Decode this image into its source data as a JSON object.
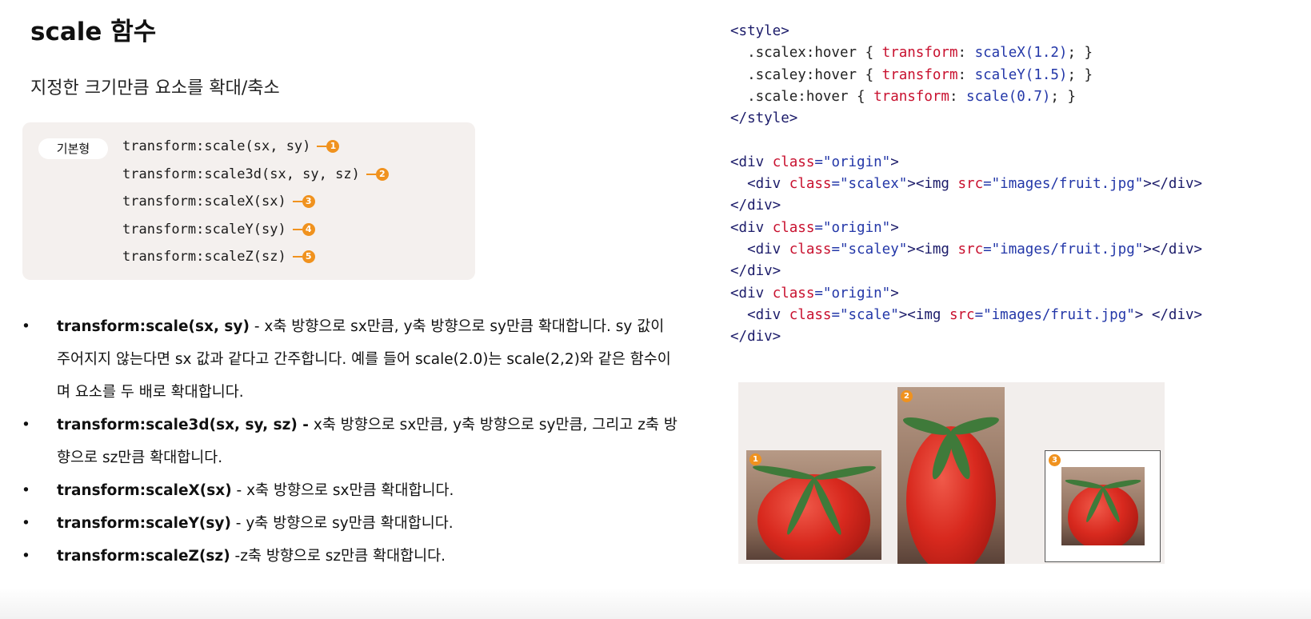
{
  "title": "scale 함수",
  "subtitle": "지정한 크기만큼 요소를 확대/축소",
  "syntax": {
    "badge": "기본형",
    "lines": [
      {
        "code": "transform:scale(sx, sy)",
        "num": "1"
      },
      {
        "code": "transform:scale3d(sx, sy, sz)",
        "num": "2"
      },
      {
        "code": "transform:scaleX(sx)",
        "num": "3"
      },
      {
        "code": "transform:scaleY(sy)",
        "num": "4"
      },
      {
        "code": "transform:scaleZ(sz)",
        "num": "5"
      }
    ]
  },
  "bullets": [
    {
      "term": "transform:scale(sx, sy)",
      "desc": " - x축 방향으로 sx만큼, y축 방향으로 sy만큼 확대합니다. sy 값이 주어지지 않는다면 sx 값과 같다고 간주합니다. 예를 들어 scale(2.0)는 scale(2,2)와 같은 함수이며 요소를 두 배로 확대합니다."
    },
    {
      "term": "transform:scale3d(sx, sy, sz) -",
      "desc": " x축 방향으로 sx만큼, y축 방향으로 sy만큼, 그리고 z축 방향으로 sz만큼 확대합니다."
    },
    {
      "term": "transform:scaleX(sx)",
      "desc": " - x축 방향으로 sx만큼 확대합니다."
    },
    {
      "term": "transform:scaleY(sy)",
      "desc": " - y축 방향으로 sy만큼 확대합니다."
    },
    {
      "term": "transform:scaleZ(sz)",
      "desc": " -z축 방향으로 sz만큼 확대합니다."
    }
  ],
  "code_lines": [
    [
      [
        "<style>",
        "tag"
      ]
    ],
    [
      [
        "  .scalex:hover { ",
        "plain"
      ],
      [
        "transform",
        "attr"
      ],
      [
        ": ",
        "plain"
      ],
      [
        "scaleX(1.2)",
        "str"
      ],
      [
        "; }",
        "plain"
      ]
    ],
    [
      [
        "  .scaley:hover { ",
        "plain"
      ],
      [
        "transform",
        "attr"
      ],
      [
        ": ",
        "plain"
      ],
      [
        "scaleY(1.5)",
        "str"
      ],
      [
        "; }",
        "plain"
      ]
    ],
    [
      [
        "  .scale:hover { ",
        "plain"
      ],
      [
        "transform",
        "attr"
      ],
      [
        ": ",
        "plain"
      ],
      [
        "scale(0.7)",
        "str"
      ],
      [
        "; }",
        "plain"
      ]
    ],
    [
      [
        "</style>",
        "tag"
      ]
    ],
    [
      [
        " ",
        "plain"
      ]
    ],
    [
      [
        "<div ",
        "tag"
      ],
      [
        "class",
        "attr"
      ],
      [
        "=\"origin\"",
        "str"
      ],
      [
        ">",
        "tag"
      ]
    ],
    [
      [
        "  <div ",
        "tag"
      ],
      [
        "class",
        "attr"
      ],
      [
        "=\"scalex\"",
        "str"
      ],
      [
        "><img ",
        "tag"
      ],
      [
        "src",
        "attr"
      ],
      [
        "=\"images/fruit.jpg\"",
        "str"
      ],
      [
        "></div>",
        "tag"
      ]
    ],
    [
      [
        "</div>",
        "tag"
      ]
    ],
    [
      [
        "<div ",
        "tag"
      ],
      [
        "class",
        "attr"
      ],
      [
        "=\"origin\"",
        "str"
      ],
      [
        ">",
        "tag"
      ]
    ],
    [
      [
        "  <div ",
        "tag"
      ],
      [
        "class",
        "attr"
      ],
      [
        "=\"scaley\"",
        "str"
      ],
      [
        "><img ",
        "tag"
      ],
      [
        "src",
        "attr"
      ],
      [
        "=\"images/fruit.jpg\"",
        "str"
      ],
      [
        "></div>",
        "tag"
      ]
    ],
    [
      [
        "</div>",
        "tag"
      ]
    ],
    [
      [
        "<div ",
        "tag"
      ],
      [
        "class",
        "attr"
      ],
      [
        "=\"origin\"",
        "str"
      ],
      [
        ">",
        "tag"
      ]
    ],
    [
      [
        "  <div ",
        "tag"
      ],
      [
        "class",
        "attr"
      ],
      [
        "=\"scale\"",
        "str"
      ],
      [
        "><img ",
        "tag"
      ],
      [
        "src",
        "attr"
      ],
      [
        "=\"images/fruit.jpg\"",
        "str"
      ],
      [
        "> </div>",
        "tag"
      ]
    ],
    [
      [
        "</div>",
        "tag"
      ]
    ]
  ],
  "demo": {
    "labels": [
      "1",
      "2",
      "3"
    ]
  },
  "colors": {
    "accent": "#f0921e",
    "attr": "#c8102e",
    "string": "#2337a8",
    "tag": "#1c1c6a",
    "box": "#f4f0ee"
  }
}
